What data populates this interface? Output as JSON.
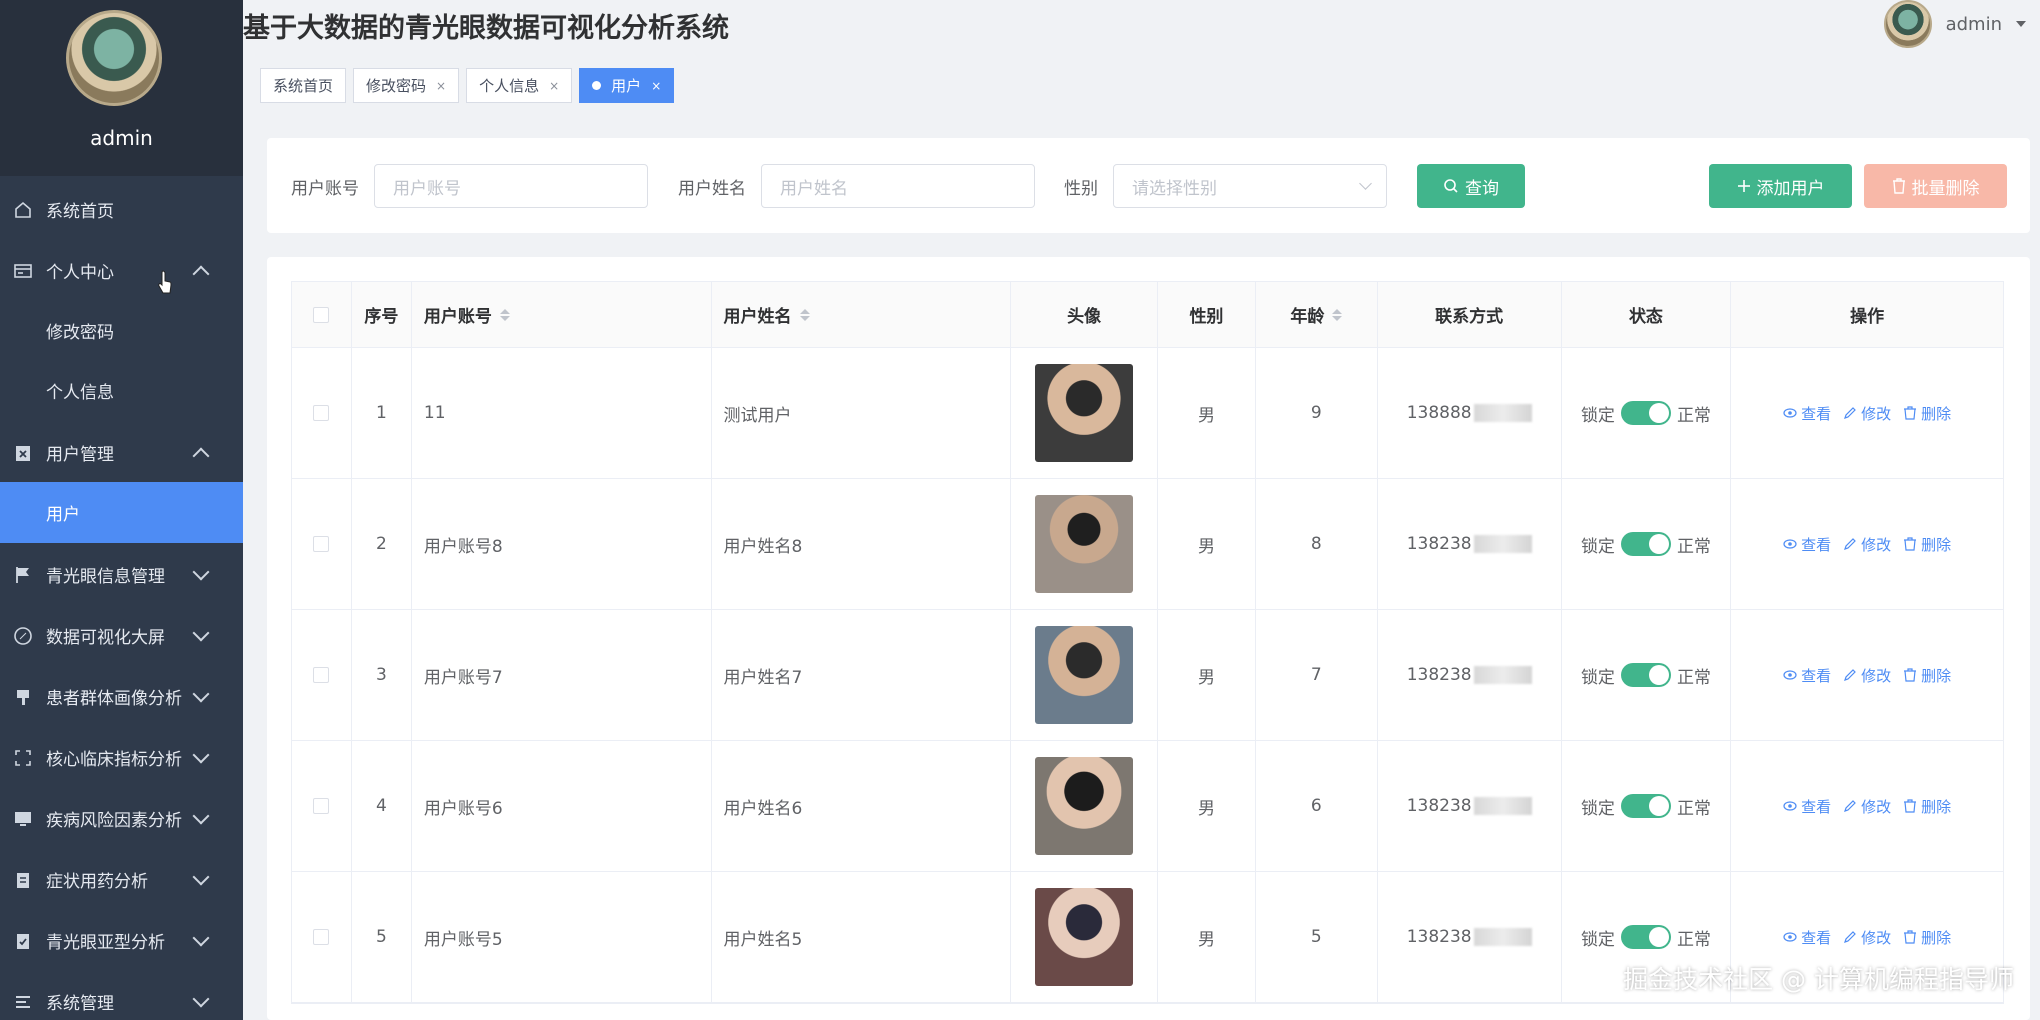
{
  "app": {
    "title": "基于大数据的青光眼数据可视化分析系统"
  },
  "user": {
    "name": "admin"
  },
  "sidebar": {
    "profile_name": "admin",
    "items": [
      {
        "label": "系统首页",
        "icon": "home-icon"
      },
      {
        "label": "个人中心",
        "icon": "card-icon"
      },
      {
        "label": "修改密码"
      },
      {
        "label": "个人信息"
      },
      {
        "label": "用户管理",
        "icon": "clipboard-x-icon"
      },
      {
        "label": "用户"
      },
      {
        "label": "青光眼信息管理",
        "icon": "flag-icon"
      },
      {
        "label": "数据可视化大屏",
        "icon": "compass-icon"
      },
      {
        "label": "患者群体画像分析",
        "icon": "brush-icon"
      },
      {
        "label": "核心临床指标分析",
        "icon": "scan-icon"
      },
      {
        "label": "疾病风险因素分析",
        "icon": "monitor-icon"
      },
      {
        "label": "症状用药分析",
        "icon": "clipboard-icon"
      },
      {
        "label": "青光眼亚型分析",
        "icon": "clipboard-check-icon"
      },
      {
        "label": "系统管理",
        "icon": "list-icon"
      }
    ]
  },
  "tabs": [
    {
      "label": "系统首页"
    },
    {
      "label": "修改密码",
      "close": "×"
    },
    {
      "label": "个人信息",
      "close": "×"
    },
    {
      "label": "用户",
      "close": "×"
    }
  ],
  "search": {
    "account_label": "用户账号",
    "account_placeholder": "用户账号",
    "name_label": "用户姓名",
    "name_placeholder": "用户姓名",
    "gender_label": "性别",
    "gender_placeholder": "请选择性别",
    "query_label": "查询",
    "add_label": "添加用户",
    "batch_delete_label": "批量删除"
  },
  "table": {
    "headers": [
      "序号",
      "用户账号",
      "用户姓名",
      "头像",
      "性别",
      "年龄",
      "联系方式",
      "状态",
      "操作"
    ],
    "rows": [
      {
        "index": "1",
        "account": "11",
        "name": "测试用户",
        "gender": "男",
        "age": "9",
        "phone": "138888"
      },
      {
        "index": "2",
        "account": "用户账号8",
        "name": "用户姓名8",
        "gender": "男",
        "age": "8",
        "phone": "138238"
      },
      {
        "index": "3",
        "account": "用户账号7",
        "name": "用户姓名7",
        "gender": "男",
        "age": "7",
        "phone": "138238"
      },
      {
        "index": "4",
        "account": "用户账号6",
        "name": "用户姓名6",
        "gender": "男",
        "age": "6",
        "phone": "138238"
      },
      {
        "index": "5",
        "account": "用户账号5",
        "name": "用户姓名5",
        "gender": "男",
        "age": "5",
        "phone": "138238"
      }
    ],
    "lock_label": "锁定",
    "normal_label": "正常",
    "view_label": "查看",
    "edit_label": "修改",
    "delete_label": "删除"
  },
  "watermark": "掘金技术社区 @ 计算机编程指导师",
  "colors": {
    "sidebar_bg": "#2f3a4b",
    "accent": "#4e8cf4",
    "green": "#41b58c",
    "danger_light": "#f8b8a8"
  }
}
